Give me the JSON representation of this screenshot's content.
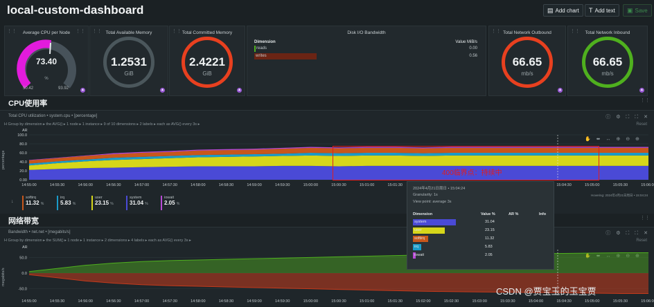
{
  "header": {
    "title": "local-custom-dashboard",
    "add_chart": "Add chart",
    "add_text": "Add text",
    "save": "Save"
  },
  "gauges": [
    {
      "title": "Average CPU per Node",
      "value": "73.40",
      "unit": "%",
      "min": "50.42",
      "max": "93.92",
      "color": "#e21bdc",
      "fraction": 0.53
    },
    {
      "title": "Total Available Memory",
      "value": "1.2531",
      "unit": "GiB",
      "color": "#4b575c",
      "fraction": 1.0
    },
    {
      "title": "Total Committed Memory",
      "value": "2.4221",
      "unit": "GiB",
      "color": "#e8401f",
      "fraction": 1.0
    },
    {
      "title": "Total Network Outbound",
      "value": "66.65",
      "unit": "mb/s",
      "color": "#e8401f",
      "fraction": 1.0
    },
    {
      "title": "Total Network Inbound",
      "value": "66.65",
      "unit": "mb/s",
      "color": "#4fb01e",
      "fraction": 1.0
    }
  ],
  "disk": {
    "title": "Disk I/O Bandwidth",
    "dim_label": "Dimension",
    "value_label": "Value MiB/s",
    "rows": [
      {
        "name": "reads",
        "value": "0.00",
        "color": "#4fb01e"
      },
      {
        "name": "writes",
        "value": "0.56",
        "color": "#c43a1c"
      }
    ]
  },
  "cpu_section": {
    "heading": "CPU使用率",
    "title": "Total CPU utilization • system.cpu • [percentage]",
    "controls": "H Group by dimension ▸ the AVG() ▸ 1 node ▸ 1 instance ▸ 9 of 10 dimensions ▸ 2 labels ▸ each as AVG() every 3s ▸",
    "reset": "Reset",
    "ar": "AR",
    "ylabel": "percentage",
    "annotation": "400临界点：持续中",
    "hovering": "Hovering: 2024年4月21日周日 • 15:04:24",
    "legend": [
      {
        "name": "softirq",
        "value": "11.32",
        "unit": "%",
        "color": "#c8571b"
      },
      {
        "name": "irq",
        "value": "5.83",
        "unit": "%",
        "color": "#1a9bc9"
      },
      {
        "name": "user",
        "value": "23.15",
        "unit": "%",
        "color": "#d6d61a"
      },
      {
        "name": "system",
        "value": "31.04",
        "unit": "%",
        "color": "#4a4ad6"
      },
      {
        "name": "iowait",
        "value": "2.05",
        "unit": "%",
        "color": "#b84ad6"
      }
    ]
  },
  "net_section": {
    "heading": "网络带宽",
    "title": "Bandwidth • net.net • [megabits/s]",
    "controls": "H Group by dimension ▸ the SUM() ▸ 1 node ▸ 1 instance ▸ 2 dimensions ▸ 4 labels ▸ each as AVG() every 3s ▸",
    "reset": "Reset",
    "ar": "AR",
    "ylabel": "megabits/s"
  },
  "tooltip": {
    "date": "2024年4月21日周日 • 15:04:24",
    "granularity": "Granularity: 1s",
    "viewpoint": "View point: average 3s",
    "h_dim": "Dimension",
    "h_val": "Value %",
    "h_ar": "AR %",
    "h_info": "Info",
    "rows": [
      {
        "name": "system",
        "value": "31.04",
        "color": "#4a4ad6",
        "frac": 0.31
      },
      {
        "name": "user",
        "value": "23.15",
        "color": "#d6d61a",
        "frac": 0.23
      },
      {
        "name": "softirq",
        "value": "11.32",
        "color": "#c8571b",
        "frac": 0.11
      },
      {
        "name": "irq",
        "value": "5.83",
        "color": "#1a9bc9",
        "frac": 0.06
      },
      {
        "name": "iowait",
        "value": "2.05",
        "color": "#b84ad6",
        "frac": 0.02
      }
    ]
  },
  "chart_data": [
    {
      "type": "area",
      "title": "Total CPU utilization",
      "ylabel": "percentage",
      "ylim": [
        0,
        100
      ],
      "y_ticks": [
        "100.0",
        "80.0",
        "60.0",
        "40.0",
        "20.0",
        "0.00"
      ],
      "x_ticks": [
        "14:55:00",
        "14:55:30",
        "14:56:00",
        "14:56:30",
        "14:57:00",
        "14:57:30",
        "14:58:00",
        "14:58:30",
        "14:59:00",
        "14:59:30",
        "15:00:00",
        "15:00:30",
        "15:01:00",
        "15:01:30",
        "15:02:00",
        "15:02:30",
        "15:03:00",
        "15:03:30",
        "15:04:00",
        "15:04:30",
        "15:05:00",
        "15:05:30",
        "15:06:00"
      ],
      "series": [
        {
          "name": "system",
          "values": [
            22,
            24,
            26,
            27,
            28,
            29,
            30,
            30,
            30,
            31,
            31,
            30,
            31,
            31,
            31,
            31,
            31,
            31,
            31,
            31,
            31,
            31,
            31
          ],
          "color": "#4a4ad6"
        },
        {
          "name": "user",
          "values": [
            10,
            13,
            15,
            17,
            18,
            19,
            20,
            21,
            22,
            22,
            23,
            23,
            23,
            23,
            22,
            23,
            23,
            23,
            23,
            23,
            23,
            23,
            23
          ],
          "color": "#d6d61a"
        },
        {
          "name": "irq",
          "values": [
            4,
            4,
            4,
            5,
            5,
            5,
            5,
            5,
            5,
            5,
            6,
            6,
            6,
            6,
            6,
            6,
            6,
            6,
            6,
            6,
            6,
            6,
            6
          ],
          "color": "#1a9bc9"
        },
        {
          "name": "softirq",
          "values": [
            7,
            7,
            8,
            8,
            9,
            9,
            10,
            10,
            10,
            11,
            11,
            11,
            11,
            11,
            11,
            11,
            11,
            11,
            11,
            11,
            11,
            11,
            11
          ],
          "color": "#c8571b"
        },
        {
          "name": "iowait",
          "values": [
            1,
            1,
            1,
            2,
            2,
            2,
            2,
            2,
            2,
            2,
            2,
            2,
            2,
            2,
            2,
            2,
            2,
            2,
            2,
            2,
            2,
            2,
            2
          ],
          "color": "#b84ad6"
        }
      ]
    },
    {
      "type": "area",
      "title": "Bandwidth",
      "ylabel": "megabits/s",
      "ylim": [
        -75,
        75
      ],
      "y_ticks": [
        "50.0",
        "0.0",
        "-50.0"
      ],
      "x_ticks": [
        "14:55:00",
        "14:55:30",
        "14:56:00",
        "14:56:30",
        "14:57:00",
        "14:57:30",
        "14:58:00",
        "14:58:30",
        "14:59:00",
        "14:59:30",
        "15:00:00",
        "15:00:30",
        "15:01:00",
        "15:01:30",
        "15:02:00",
        "15:02:30",
        "15:03:00",
        "15:03:30",
        "15:04:00",
        "15:04:30",
        "15:05:00",
        "15:05:30",
        "15:06:00"
      ],
      "series": [
        {
          "name": "received",
          "values": [
            5,
            15,
            25,
            32,
            37,
            40,
            42,
            44,
            46,
            48,
            50,
            52,
            54,
            56,
            58,
            59,
            60,
            61,
            62,
            63,
            64,
            65,
            65
          ],
          "color": "#4fb01e"
        },
        {
          "name": "sent",
          "values": [
            -5,
            -15,
            -25,
            -32,
            -37,
            -40,
            -42,
            -44,
            -46,
            -48,
            -50,
            -52,
            -54,
            -56,
            -58,
            -59,
            -60,
            -61,
            -62,
            -63,
            -64,
            -65,
            -65
          ],
          "color": "#c43a1c"
        }
      ]
    }
  ],
  "watermark": "CSDN @贾宝玉的玉宝贾"
}
